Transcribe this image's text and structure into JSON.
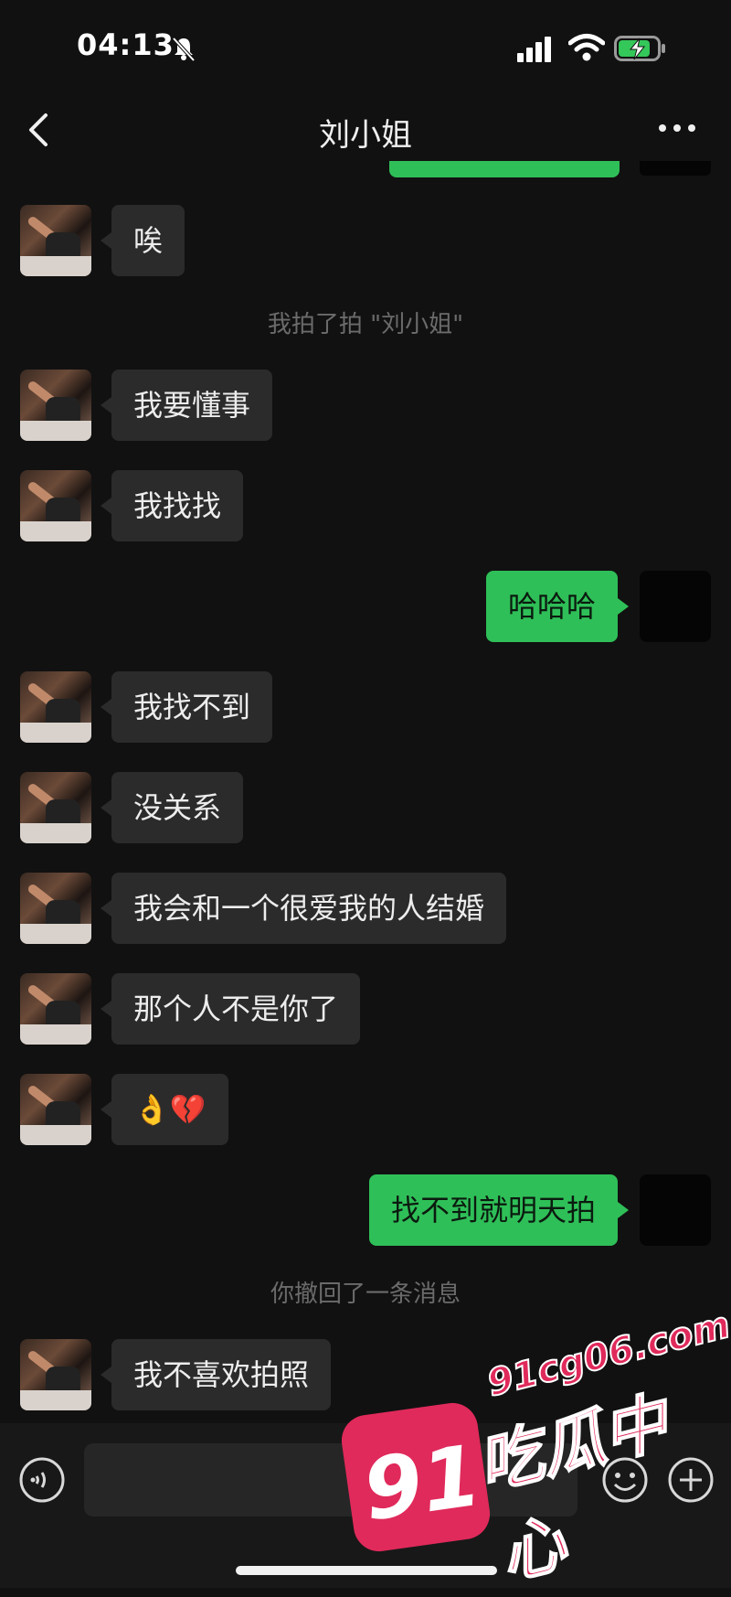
{
  "status_bar": {
    "time": "04:13"
  },
  "chat": {
    "title": "刘小姐"
  },
  "messages": [
    {
      "side": "left",
      "text": "唉"
    },
    {
      "side": "system",
      "text": "我拍了拍 \"刘小姐\""
    },
    {
      "side": "left",
      "text": "我要懂事"
    },
    {
      "side": "left",
      "text": "我找找"
    },
    {
      "side": "right",
      "text": "哈哈哈"
    },
    {
      "side": "left",
      "text": "我找不到"
    },
    {
      "side": "left",
      "text": "没关系"
    },
    {
      "side": "left",
      "text": "我会和一个很爱我的人结婚"
    },
    {
      "side": "left",
      "text": "那个人不是你了"
    },
    {
      "side": "left",
      "text": "👌💔"
    },
    {
      "side": "right",
      "text": "找不到就明天拍"
    },
    {
      "side": "system",
      "text": "你撤回了一条消息"
    },
    {
      "side": "left",
      "text": "我不喜欢拍照"
    }
  ],
  "watermark": {
    "badge": "91",
    "url": "91cg06.com",
    "name": "吃瓜中心"
  },
  "colors": {
    "accent": "#2fbf58",
    "bubble": "#2b2b2b",
    "background": "#111111",
    "watermark": "#e02a5b"
  }
}
